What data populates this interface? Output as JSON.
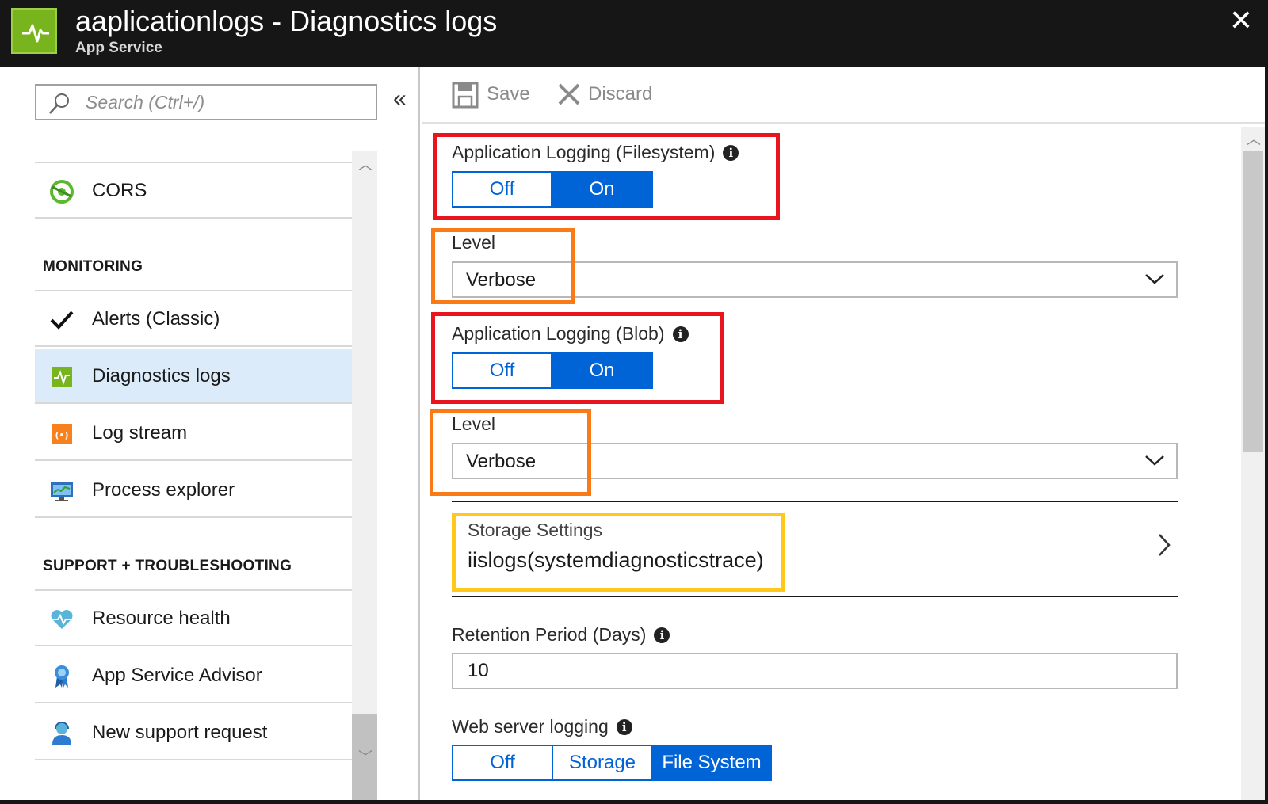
{
  "header": {
    "title": "aaplicationlogs - Diagnostics logs",
    "subtitle": "App Service",
    "close_label": "✕"
  },
  "nav": {
    "search_placeholder": "Search (Ctrl+/)",
    "collapse_label": "«",
    "items_top": [
      {
        "label": "CORS",
        "icon": "cors-icon"
      }
    ],
    "monitoring_header": "MONITORING",
    "monitoring_items": [
      {
        "label": "Alerts (Classic)",
        "icon": "checkmark-icon"
      },
      {
        "label": "Diagnostics logs",
        "icon": "diagnostics-icon",
        "selected": true
      },
      {
        "label": "Log stream",
        "icon": "log-stream-icon"
      },
      {
        "label": "Process explorer",
        "icon": "process-explorer-icon"
      }
    ],
    "support_header": "SUPPORT + TROUBLESHOOTING",
    "support_items": [
      {
        "label": "Resource health",
        "icon": "heart-icon"
      },
      {
        "label": "App Service Advisor",
        "icon": "advisor-ribbon-icon"
      },
      {
        "label": "New support request",
        "icon": "support-person-icon"
      }
    ]
  },
  "toolbar": {
    "save_label": "Save",
    "discard_label": "Discard"
  },
  "form": {
    "app_logging_fs": {
      "label": "Application Logging (Filesystem)",
      "options": [
        "Off",
        "On"
      ],
      "selected": "On"
    },
    "level_fs": {
      "label": "Level",
      "value": "Verbose"
    },
    "app_logging_blob": {
      "label": "Application Logging (Blob)",
      "options": [
        "Off",
        "On"
      ],
      "selected": "On"
    },
    "level_blob": {
      "label": "Level",
      "value": "Verbose"
    },
    "storage": {
      "title": "Storage Settings",
      "value": "iislogs(systemdiagnosticstrace)"
    },
    "retention": {
      "label": "Retention Period (Days)",
      "value": "10"
    },
    "web_server_logging": {
      "label": "Web server logging",
      "options": [
        "Off",
        "Storage",
        "File System"
      ],
      "selected": "File System"
    }
  },
  "colors": {
    "titlebar": "#161616",
    "accent_blue": "#0063d6",
    "selected_nav": "#dcebfa",
    "highlight_red": "#e8141e",
    "highlight_orange": "#f97a16",
    "highlight_yellow": "#ffc81a",
    "app_logo_green": "#78b41e"
  }
}
